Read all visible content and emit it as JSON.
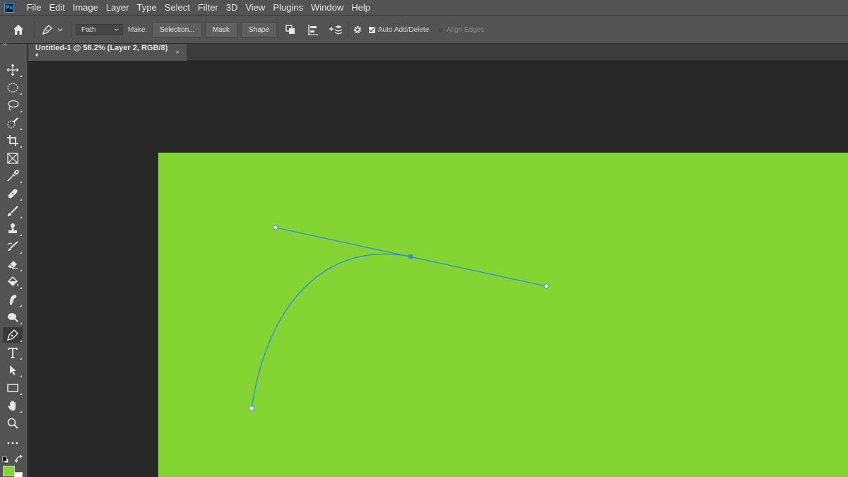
{
  "app": {
    "logo_text": "Ps",
    "name": "Adobe Photoshop"
  },
  "menu": [
    "File",
    "Edit",
    "Image",
    "Layer",
    "Type",
    "Select",
    "Filter",
    "3D",
    "View",
    "Plugins",
    "Window",
    "Help"
  ],
  "options": {
    "path_mode": "Path",
    "make_label": "Make:",
    "selection_label": "Selection...",
    "mask_label": "Mask",
    "shape_label": "Shape",
    "auto_add_delete_label": "Auto Add/Delete",
    "auto_add_delete_checked": true,
    "align_edges_label": "Align Edges",
    "align_edges_checked": false
  },
  "document_tab": {
    "title": "Untitled-1 @ 58.2% (Layer 2, RGB/8) *",
    "close_glyph": "×"
  },
  "toolbar": {
    "tools": [
      "move-tool",
      "marquee-tool",
      "lasso-tool",
      "quick-selection-tool",
      "crop-tool",
      "frame-tool",
      "eyedropper-tool",
      "healing-brush-tool",
      "brush-tool",
      "clone-stamp-tool",
      "history-brush-tool",
      "eraser-tool",
      "paint-bucket-tool",
      "smudge-tool",
      "dodge-tool",
      "pen-tool",
      "type-tool",
      "path-selection-tool",
      "rectangle-tool",
      "hand-tool",
      "zoom-tool",
      "more-tools"
    ],
    "active_tool": "pen-tool",
    "foreground_color": "#84d433",
    "background_color": "#ffffff"
  },
  "canvas": {
    "fill_color": "#84d433",
    "path_color": "#2e8fe0"
  }
}
